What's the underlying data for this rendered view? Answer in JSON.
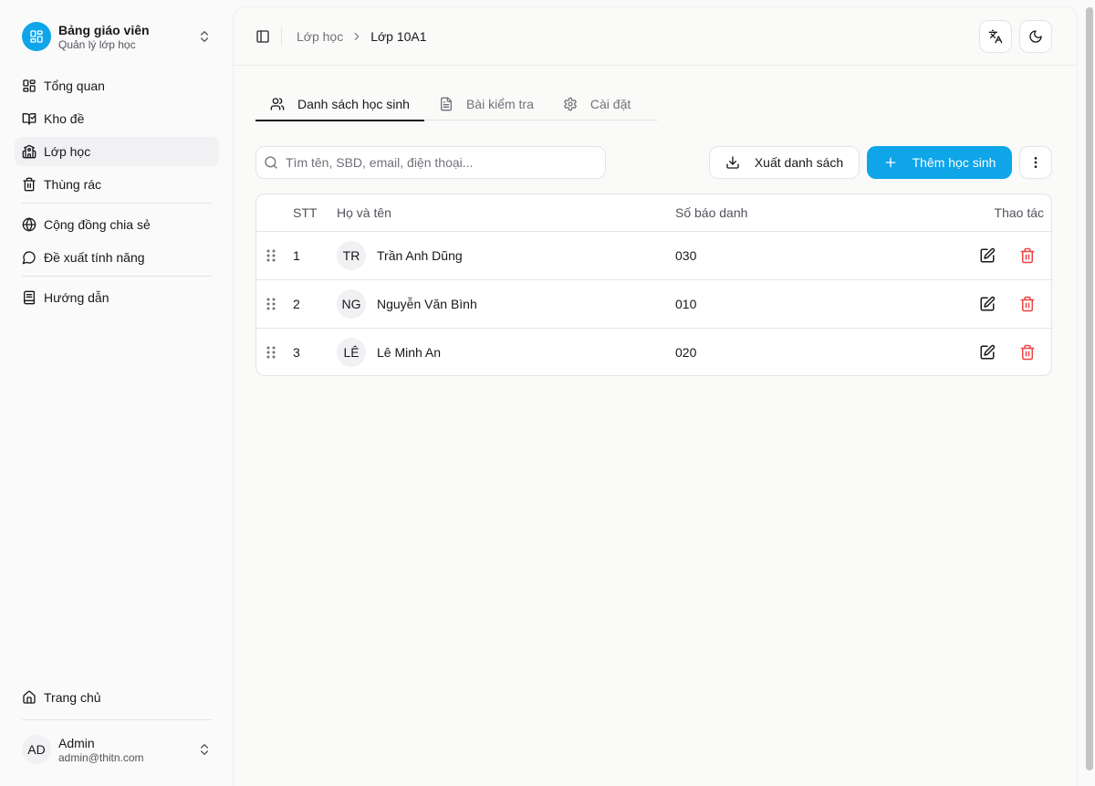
{
  "sidebar": {
    "brand": {
      "title": "Bảng giáo viên",
      "subtitle": "Quản lý lớp học",
      "icon": "dashboard-icon"
    },
    "items": [
      {
        "label": "Tổng quan",
        "icon": "grid-icon",
        "active": false
      },
      {
        "label": "Kho đề",
        "icon": "book-check-icon",
        "active": false
      },
      {
        "label": "Lớp học",
        "icon": "school-icon",
        "active": true
      },
      {
        "label": "Thùng rác",
        "icon": "trash-icon",
        "active": false
      },
      {
        "label": "Cộng đồng chia sẻ",
        "icon": "globe-icon",
        "active": false
      },
      {
        "label": "Đề xuất tính năng",
        "icon": "message-icon",
        "active": false
      },
      {
        "label": "Hướng dẫn",
        "icon": "book-icon",
        "active": false
      }
    ],
    "home": {
      "label": "Trang chủ",
      "icon": "home-icon"
    },
    "user": {
      "initials": "AD",
      "name": "Admin",
      "email": "admin@thitn.com"
    }
  },
  "header": {
    "breadcrumb": {
      "parent": "Lớp học",
      "current": "Lớp 10A1"
    }
  },
  "tabs": [
    {
      "label": "Danh sách học sinh",
      "icon": "users-icon",
      "active": true
    },
    {
      "label": "Bài kiểm tra",
      "icon": "file-text-icon",
      "active": false
    },
    {
      "label": "Cài đặt",
      "icon": "settings-icon",
      "active": false
    }
  ],
  "toolbar": {
    "search_placeholder": "Tìm tên, SBD, email, điện thoại...",
    "export_label": "Xuất danh sách",
    "add_label": "Thêm học sinh"
  },
  "table": {
    "columns": {
      "stt": "STT",
      "name": "Họ và tên",
      "sbd": "Số báo danh",
      "actions": "Thao tác"
    },
    "rows": [
      {
        "stt": "1",
        "initials": "TR",
        "name": "Trần Anh Dũng",
        "sbd": "030"
      },
      {
        "stt": "2",
        "initials": "NG",
        "name": "Nguyễn Văn Bình",
        "sbd": "010"
      },
      {
        "stt": "3",
        "initials": "LÊ",
        "name": "Lê Minh An",
        "sbd": "020"
      }
    ]
  },
  "colors": {
    "accent": "#0ea5e9",
    "danger": "#ef4444"
  }
}
